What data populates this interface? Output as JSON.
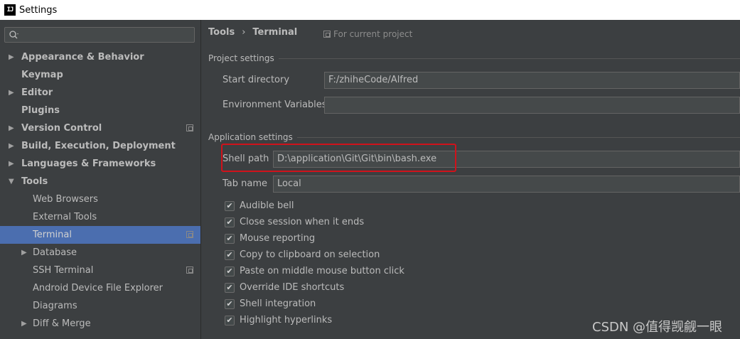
{
  "window": {
    "app_logo": "IJ",
    "title": "Settings"
  },
  "search": {
    "placeholder": ""
  },
  "sidebar": {
    "items": [
      {
        "label": "Appearance & Behavior",
        "arrow": "▶"
      },
      {
        "label": "Keymap"
      },
      {
        "label": "Editor",
        "arrow": "▶"
      },
      {
        "label": "Plugins"
      },
      {
        "label": "Version Control",
        "arrow": "▶"
      },
      {
        "label": "Build, Execution, Deployment",
        "arrow": "▶"
      },
      {
        "label": "Languages & Frameworks",
        "arrow": "▶"
      },
      {
        "label": "Tools",
        "arrow": "▼"
      },
      {
        "label": "Web Browsers"
      },
      {
        "label": "External Tools"
      },
      {
        "label": "Terminal"
      },
      {
        "label": "Database",
        "arrow": "▶"
      },
      {
        "label": "SSH Terminal"
      },
      {
        "label": "Android Device File Explorer"
      },
      {
        "label": "Diagrams"
      },
      {
        "label": "Diff & Merge",
        "arrow": "▶"
      }
    ]
  },
  "breadcrumb": {
    "parent": "Tools",
    "separator": "›",
    "current": "Terminal"
  },
  "scope": {
    "label": "For current project"
  },
  "project_settings": {
    "heading": "Project settings",
    "start_directory_label": "Start directory",
    "start_directory_value": "F:/zhiheCode/Alfred",
    "env_vars_label": "Environment Variables",
    "env_vars_value": ""
  },
  "application_settings": {
    "heading": "Application settings",
    "shell_path_label": "Shell path",
    "shell_path_value": "D:\\application\\Git\\Git\\bin\\bash.exe",
    "tab_name_label": "Tab name",
    "tab_name_value": "Local",
    "highlight_color": "#d0121b"
  },
  "options": [
    {
      "label": "Audible bell",
      "checked": true
    },
    {
      "label": "Close session when it ends",
      "checked": true
    },
    {
      "label": "Mouse reporting",
      "checked": true
    },
    {
      "label": "Copy to clipboard on selection",
      "checked": true
    },
    {
      "label": "Paste on middle mouse button click",
      "checked": true
    },
    {
      "label": "Override IDE shortcuts",
      "checked": true
    },
    {
      "label": "Shell integration",
      "checked": true
    },
    {
      "label": "Highlight hyperlinks",
      "checked": true
    }
  ],
  "check_glyph": "✔",
  "watermark": "CSDN @值得觊觎一眼",
  "colors": {
    "background": "#3c3f41",
    "selection": "#4b6eaf",
    "field_background": "#45494a"
  }
}
